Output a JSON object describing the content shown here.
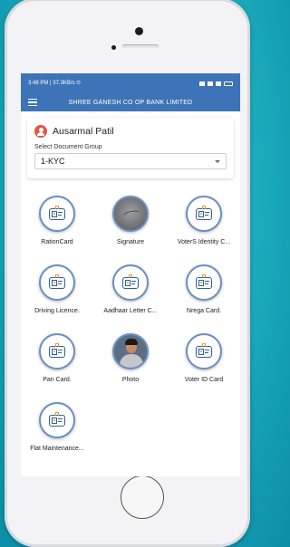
{
  "status_bar": {
    "left": "3:48 PM | 37.3KB/s ⏲",
    "right_icons": [
      "alarm-icon",
      "wifi-icon",
      "signal-icon",
      "battery-icon"
    ]
  },
  "app_bar": {
    "menu_icon": "hamburger-icon",
    "title": "SHREE GANESH CO OP BANK LIMITED"
  },
  "user": {
    "name": "Ausarmal Patil",
    "icon": "user-icon",
    "accent_color": "#e05545"
  },
  "document_group": {
    "label": "Select Document Group",
    "selected": "1-KYC"
  },
  "documents": [
    {
      "label": "RationCard",
      "icon": "id-card-icon"
    },
    {
      "label": "Signature",
      "icon": "signature-photo"
    },
    {
      "label": "VoterS Identity C...",
      "icon": "id-card-icon"
    },
    {
      "label": "Driving Licence.",
      "icon": "id-card-icon"
    },
    {
      "label": "Aadhaar Letter C...",
      "icon": "id-card-icon"
    },
    {
      "label": "Nrega Card.",
      "icon": "id-card-icon"
    },
    {
      "label": "Pan Card.",
      "icon": "id-card-icon"
    },
    {
      "label": "Photo",
      "icon": "person-photo"
    },
    {
      "label": "Voter ID Card",
      "icon": "id-card-icon"
    },
    {
      "label": "Flat Maintenance...",
      "icon": "id-card-icon"
    }
  ],
  "colors": {
    "primary": "#3d74b7",
    "background": "#1fb2c3"
  }
}
